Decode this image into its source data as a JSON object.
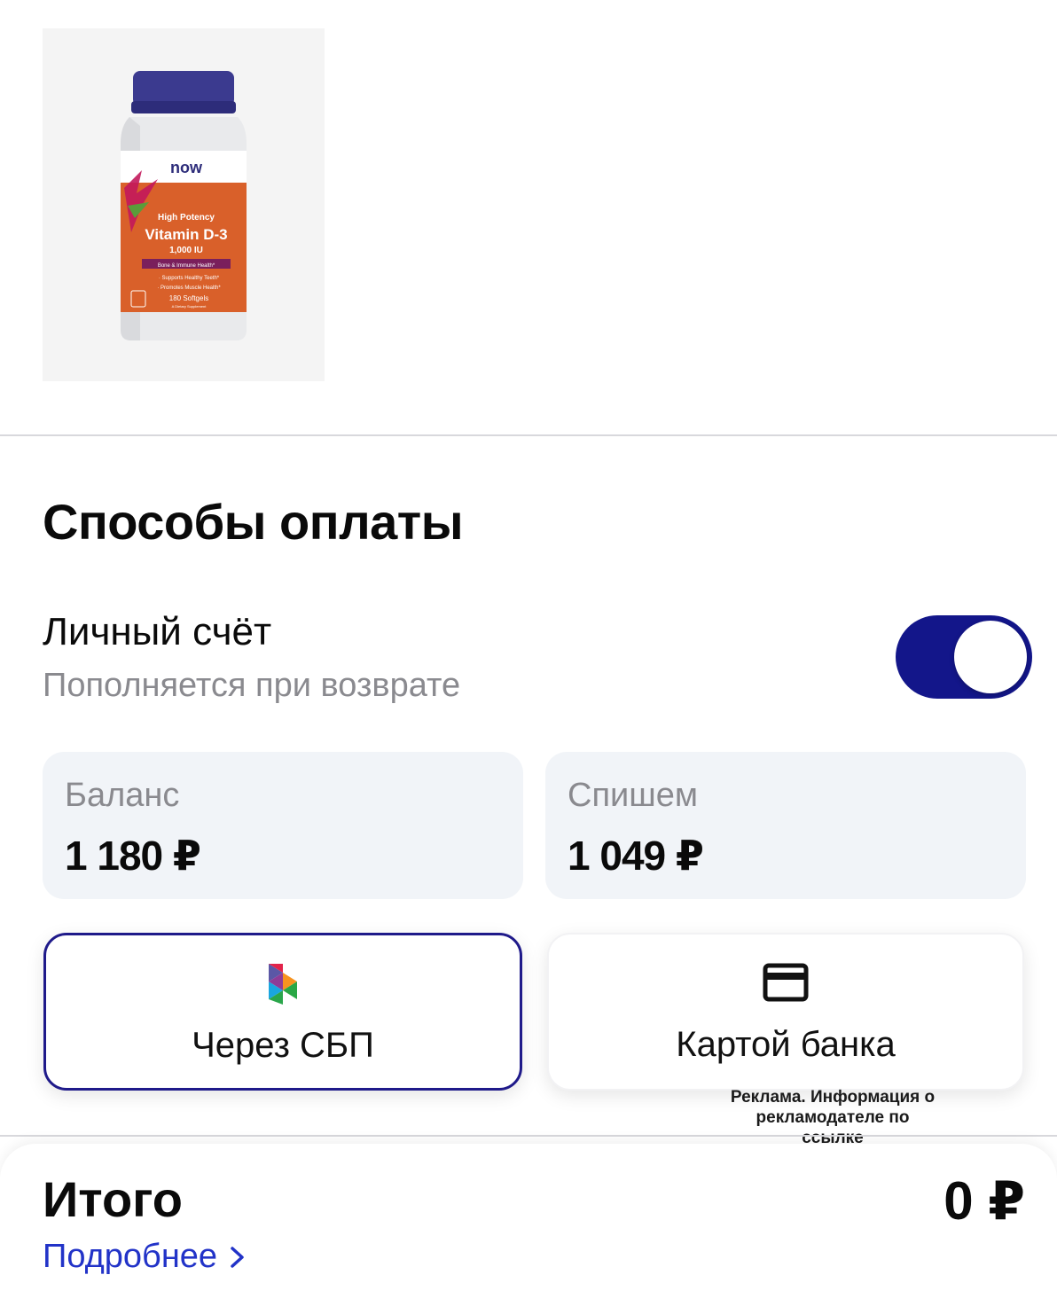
{
  "product": {
    "image_name": "vitamin-d3-bottle",
    "brand": "now",
    "label_line1": "High Potency",
    "label_line2": "Vitamin D-3",
    "label_line3": "1,000 IU",
    "label_line4": "Bone & Immune Health*",
    "label_line5": "· Supports Healthy Teeth*",
    "label_line6": "· Promotes Muscle Health*",
    "label_line7": "180 Softgels",
    "label_line8": "A Dietary Supplement"
  },
  "payment": {
    "title": "Способы оплаты",
    "personal_account": {
      "label": "Личный счёт",
      "sublabel": "Пополняется при возврате",
      "toggle_on": true
    },
    "balance": {
      "label": "Баланс",
      "value": "1 180 ₽"
    },
    "debit": {
      "label": "Спишем",
      "value": "1 049 ₽"
    },
    "options": [
      {
        "label": "Через СБП",
        "icon": "sbp-logo-icon",
        "selected": true
      },
      {
        "label": "Картой банка",
        "icon": "bank-card-icon",
        "selected": false
      }
    ],
    "ad_note": "Реклама. Информация о рекламодателе по ссылке"
  },
  "summary": {
    "total_label": "Итого",
    "total_value": "0 ₽",
    "details_link": "Подробнее"
  },
  "colors": {
    "toggle": "#13168a",
    "link": "#2233c8",
    "selected_border": "#1f1a8a",
    "card_bg": "#f1f4f8",
    "label_orange": "#d9602a"
  }
}
